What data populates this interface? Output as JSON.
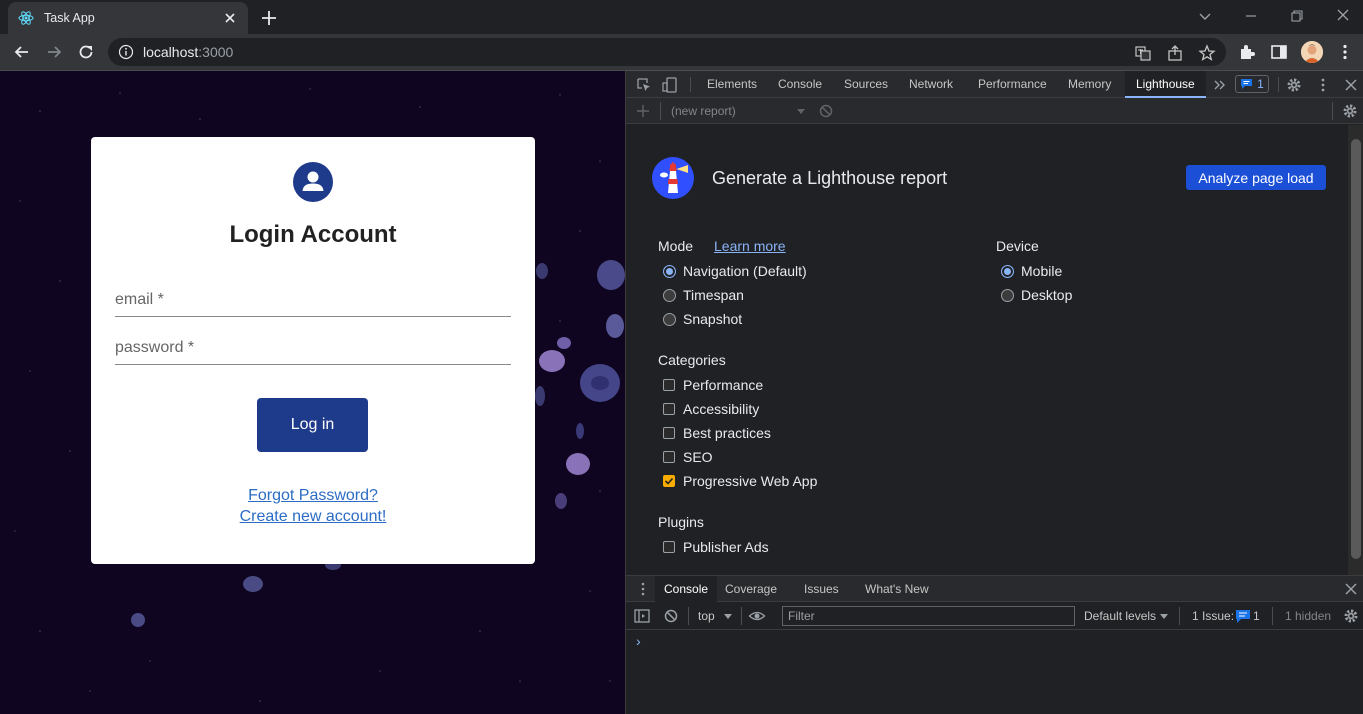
{
  "browser": {
    "tab_title": "Task App",
    "url_host": "localhost",
    "url_port": ":3000"
  },
  "page": {
    "heading": "Login Account",
    "email_placeholder": "email *",
    "password_placeholder": "password *",
    "login_button": "Log in",
    "forgot_password": "Forgot Password?",
    "create_account": "Create new account!"
  },
  "devtools": {
    "tabs": [
      "Elements",
      "Console",
      "Sources",
      "Network",
      "Performance",
      "Memory",
      "Lighthouse"
    ],
    "active_tab": "Lighthouse",
    "issues_count": "1",
    "lighthouse": {
      "report_select": "(new report)",
      "heading": "Generate a Lighthouse report",
      "analyze_button": "Analyze page load",
      "mode_label": "Mode",
      "learn_more": "Learn more",
      "modes": [
        "Navigation (Default)",
        "Timespan",
        "Snapshot"
      ],
      "selected_mode": "Navigation (Default)",
      "device_label": "Device",
      "devices": [
        "Mobile",
        "Desktop"
      ],
      "selected_device": "Mobile",
      "categories_label": "Categories",
      "categories": [
        {
          "label": "Performance",
          "checked": false
        },
        {
          "label": "Accessibility",
          "checked": false
        },
        {
          "label": "Best practices",
          "checked": false
        },
        {
          "label": "SEO",
          "checked": false
        },
        {
          "label": "Progressive Web App",
          "checked": true
        }
      ],
      "plugins_label": "Plugins",
      "plugins": [
        {
          "label": "Publisher Ads",
          "checked": false
        }
      ]
    },
    "drawer": {
      "tabs": [
        "Console",
        "Coverage",
        "Issues",
        "What's New"
      ],
      "active_tab": "Console",
      "context": "top",
      "filter_placeholder": "Filter",
      "levels": "Default levels",
      "issues_label": "1 Issue:",
      "issues_count": "1",
      "hidden": "1 hidden",
      "prompt": "›"
    }
  },
  "colors": {
    "primary_button": "#1e3a8a",
    "analyze_button": "#1a4fd6",
    "page_background": "#0f0521",
    "checkbox_accent": "#f9ab00"
  }
}
